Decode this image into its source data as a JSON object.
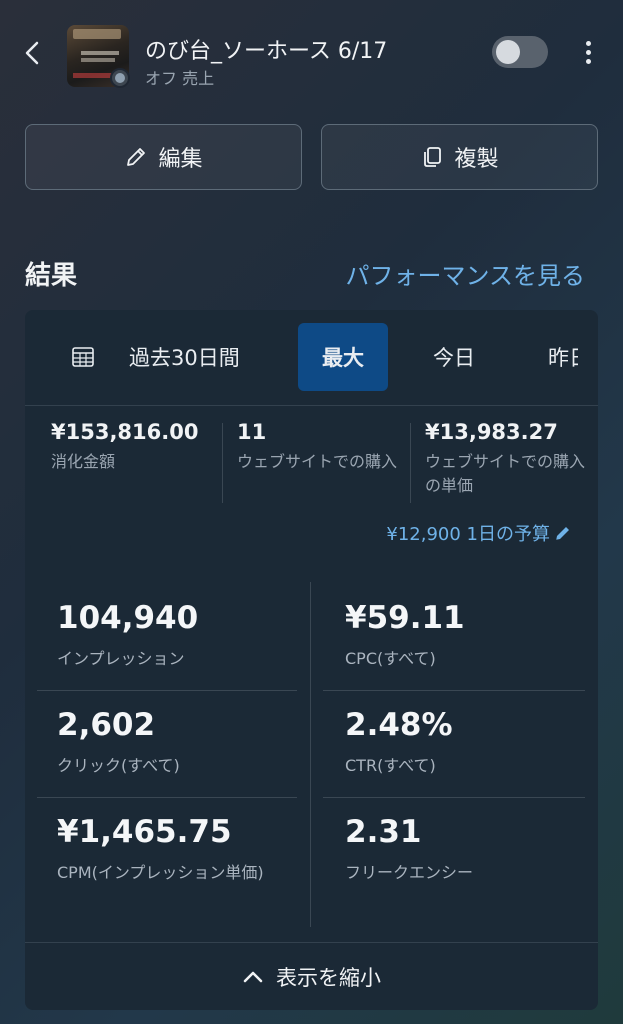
{
  "header": {
    "title": "のび台_ソーホース 6/17",
    "subtitle": "オフ 売上"
  },
  "actions": {
    "edit_label": "編集",
    "duplicate_label": "複製"
  },
  "results": {
    "title": "結果",
    "performance_link": "パフォーマンスを見る"
  },
  "date_tabs": [
    {
      "label": "過去30日間"
    },
    {
      "label": "最大",
      "selected": true
    },
    {
      "label": "今日"
    },
    {
      "label": "昨日"
    }
  ],
  "summary": [
    {
      "value": "¥153,816.00",
      "label": "消化金額"
    },
    {
      "value": "11",
      "label": "ウェブサイトでの購入"
    },
    {
      "value": "¥13,983.27",
      "label": "ウェブサイトでの購入の単価"
    }
  ],
  "budget": "¥12,900 1日の予算",
  "metrics": [
    {
      "value": "104,940",
      "label": "インプレッション"
    },
    {
      "value": "¥59.11",
      "label": "CPC(すべて)"
    },
    {
      "value": "2,602",
      "label": "クリック(すべて)"
    },
    {
      "value": "2.48%",
      "label": "CTR(すべて)"
    },
    {
      "value": "¥1,465.75",
      "label": "CPM(インプレッション単価)"
    },
    {
      "value": "2.31",
      "label": "フリークエンシー"
    }
  ],
  "footer": {
    "collapse_label": "表示を縮小"
  },
  "colors": {
    "accent": "#6fb2e8",
    "selected_tab": "#0e4a86"
  }
}
